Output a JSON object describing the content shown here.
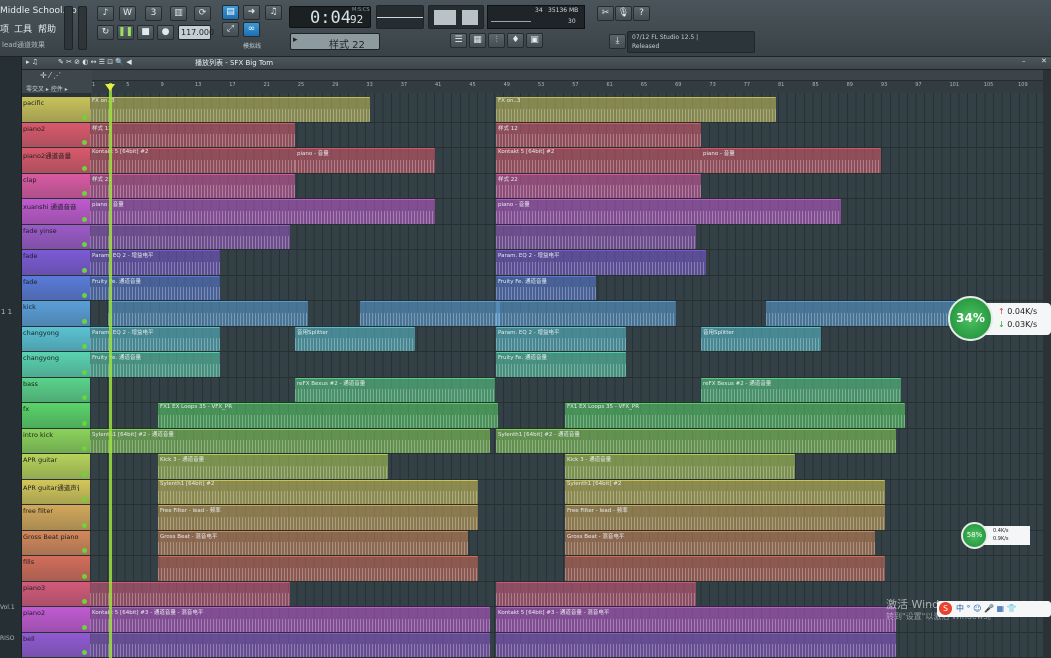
{
  "window": {
    "project_name": "Middle School.flp"
  },
  "menu": {
    "item1": "项",
    "item2": "工具",
    "item3": "帮助",
    "hint_label": "lead通道效果"
  },
  "transport": {
    "tempo": "117.000",
    "time_main": "0:04",
    "time_ms": "92",
    "ms_label": "M:S:CS",
    "pattern": "样式 22",
    "snap_label": "模拟线"
  },
  "cpu": {
    "voices": "34",
    "memory": "35136 MB",
    "polyphony": "30"
  },
  "hint": {
    "line1": "07/12  FL Studio 12.5 |",
    "line2": "Released"
  },
  "playlist": {
    "title": "播放列表 - SFX Big Tom",
    "header_left": "零交叉 ▸ 控件 ▸"
  },
  "ruler_ticks": [
    "1",
    "5",
    "9",
    "13",
    "17",
    "21",
    "25",
    "29",
    "33",
    "37",
    "41",
    "45",
    "49",
    "53",
    "57",
    "61",
    "65",
    "69",
    "73",
    "77",
    "81",
    "85",
    "89",
    "93",
    "97",
    "101",
    "105",
    "109",
    "113"
  ],
  "tracks": [
    {
      "label": "pacific",
      "color": "#c9c25a"
    },
    {
      "label": "piano2",
      "color": "#d9596b"
    },
    {
      "label": "piano2通道音量",
      "color": "#d9596b"
    },
    {
      "label": "clap",
      "color": "#d95aa4"
    },
    {
      "label": "xuanshi 通道音音",
      "color": "#c15ad0"
    },
    {
      "label": "fade yinse",
      "color": "#9c5ac9"
    },
    {
      "label": "fade",
      "color": "#7c5ad6"
    },
    {
      "label": "fade",
      "color": "#5a7bd9"
    },
    {
      "label": "kick",
      "color": "#5a9fd9"
    },
    {
      "label": "changyong",
      "color": "#5ac3d3"
    },
    {
      "label": "changyong",
      "color": "#5ad3b0"
    },
    {
      "label": "bass",
      "color": "#5ad38a"
    },
    {
      "label": "fx",
      "color": "#5ad369"
    },
    {
      "label": "intro kick",
      "color": "#8bd35a"
    },
    {
      "label": "APR guitar",
      "color": "#b6d35a"
    },
    {
      "label": "APR guitar通道声音",
      "color": "#d3c75a"
    },
    {
      "label": "free filter",
      "color": "#d3a85a"
    },
    {
      "label": "Gross Beat piano2",
      "color": "#d3885a"
    },
    {
      "label": "fills",
      "color": "#d36d5a"
    },
    {
      "label": "piano3",
      "color": "#d35a7a"
    },
    {
      "label": "piano2",
      "color": "#c25ad3"
    },
    {
      "label": "bell",
      "color": "#915ad3"
    }
  ],
  "clips_text": {
    "fx_on": "FX on..3",
    "pattern12": "样式 12",
    "kontakt": "Kontakt 5 [64bit] #2",
    "piano_vol": "piano - 音量",
    "pattern22": "样式 22",
    "param_eq": "Param. EQ 2 - 增益电平",
    "fruity_fe": "Fruity Fe. 通道音量",
    "splitter": "音用Splitter",
    "fx_bexus": "reFX Bexus #2 - 通道音量",
    "vfx": "FX1 EX Loops 35 - VFX_PR",
    "sylenth": "Sylenth1 [64bit] #2 - 通道音量",
    "kick3": "Kick 3 - 通道音量",
    "sylenth_b": "Sylenth1 [64bit] #2",
    "free_filter": "Free Filter - lead - 频率",
    "gross_beat": "Gross Beat - 混音电平",
    "kontakt_vol": "Kontakt 5 [64bit] #3 - 通道音量 - 混音电平"
  },
  "network": {
    "big_percent": "34%",
    "big_up": "0.04K/s",
    "big_down": "0.03K/s",
    "small_percent": "58%",
    "small_up": "0.4K/s",
    "small_down": "0.9K/s"
  },
  "watermark": {
    "line1": "激活 Windows",
    "line2": "转到\"设置\"以激活 Windows。"
  },
  "ime": {
    "text": "中 ° ☺ 🎤 ▦ 👕"
  },
  "colors": {
    "playhead": "#9ee33a",
    "accent_blue": "#3b9ad9"
  }
}
